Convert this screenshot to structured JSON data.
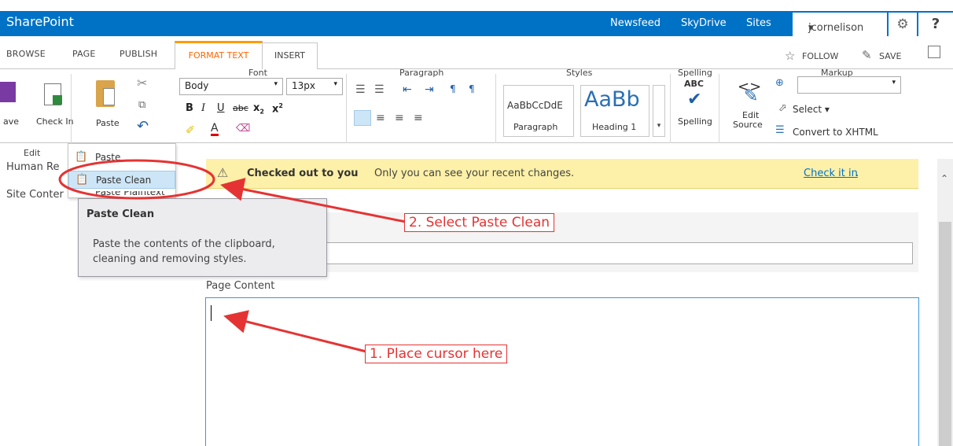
{
  "colors": {
    "suite_blue": "#0072c6",
    "active_tab": "#ff6600",
    "status_bg": "#fdf0a8",
    "annotation_red": "#e53333"
  },
  "suitebar": {
    "brand": "SharePoint",
    "links": [
      "Newsfeed",
      "SkyDrive",
      "Sites"
    ],
    "user": "jcornelison",
    "user_caret": "▾",
    "settings_icon": "gear-icon",
    "help": "?"
  },
  "tabs": {
    "browse": "BROWSE",
    "page": "PAGE",
    "publish": "PUBLISH",
    "format_text": "FORMAT TEXT",
    "insert": "INSERT"
  },
  "ribbon_tools": {
    "follow": "FOLLOW",
    "save": "SAVE"
  },
  "ribbon": {
    "edit": {
      "save": "ave",
      "check_in": "Check In",
      "group": "Edit"
    },
    "clipboard": {
      "paste": "Paste"
    },
    "font": {
      "style": "Body",
      "size": "13px",
      "bold": "B",
      "italic": "I",
      "underline": "U",
      "strike": "abc",
      "sub": "x",
      "sup": "x",
      "group": "Font"
    },
    "paragraph": {
      "group": "Paragraph"
    },
    "styles": {
      "sample1": "AaBbCcDdE",
      "label1": "Paragraph",
      "sample2": "AaBb",
      "label2": "Heading 1",
      "group": "Styles"
    },
    "spelling": {
      "abc": "ABC",
      "label": "Spelling",
      "group": "Spelling"
    },
    "markup": {
      "edit_source_1": "Edit",
      "edit_source_2": "Source",
      "select": "Select",
      "convert": "Convert to XHTML",
      "group": "Markup"
    }
  },
  "left_nav": {
    "item1": "Human Re",
    "item2": "Site Conter"
  },
  "status": {
    "bold": "Checked out to you",
    "text": "Only you can see your recent changes.",
    "link": "Check it in",
    "period": "."
  },
  "paste_menu": {
    "items": [
      "Paste",
      "Paste Clean",
      "Paste Plaintext"
    ]
  },
  "tooltip": {
    "title": "Paste Clean",
    "body": "Paste the contents of the clipboard, cleaning and removing styles."
  },
  "content": {
    "page_content_label": "Page Content"
  },
  "annotations": {
    "step2": "2. Select Paste Clean",
    "step1": "1. Place cursor here"
  }
}
